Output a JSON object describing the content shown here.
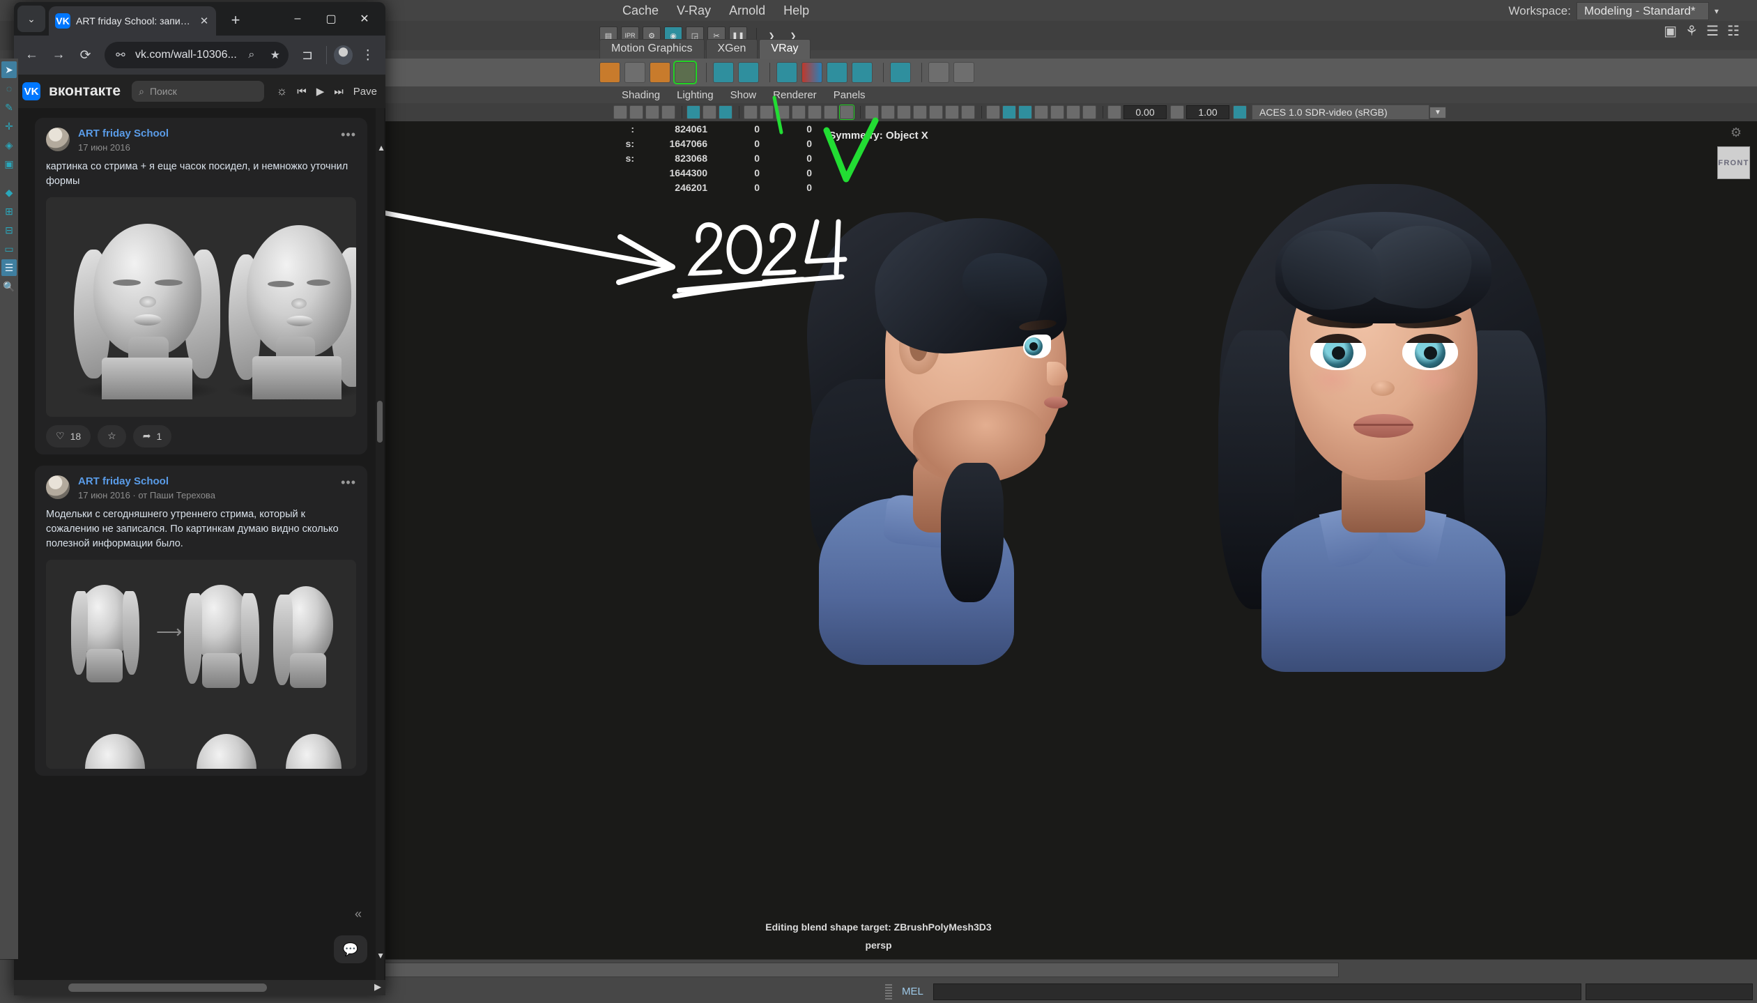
{
  "maya": {
    "menubar": [
      "Cache",
      "V-Ray",
      "Arnold",
      "Help"
    ],
    "workspace_label": "Workspace:",
    "workspace_value": "Modeling - Standard*",
    "shelf_tabs": [
      {
        "label": "Motion Graphics",
        "active": false
      },
      {
        "label": "XGen",
        "active": false
      },
      {
        "label": "VRay",
        "active": true
      }
    ],
    "panel_menus": [
      "Shading",
      "Lighting",
      "Show",
      "Renderer",
      "Panels"
    ],
    "view_toolbar": {
      "gamma": "0.00",
      "exposure": "1.00",
      "color_management": "ACES 1.0 SDR-video (sRGB)"
    },
    "hud": {
      "symmetry": "Symmetry: Object X",
      "viewcube": "FRONT",
      "rows": [
        {
          "label": ":",
          "v1": "824061",
          "v2": "0",
          "v3": "0"
        },
        {
          "label": "s:",
          "v1": "1647066",
          "v2": "0",
          "v3": "0"
        },
        {
          "label": "s:",
          "v1": "823068",
          "v2": "0",
          "v3": "0"
        },
        {
          "label": "",
          "v1": "1644300",
          "v2": "0",
          "v3": "0"
        },
        {
          "label": "",
          "v1": "246201",
          "v2": "0",
          "v3": "0"
        }
      ],
      "status_line": "Editing blend shape target: ZBrushPolyMesh3D3",
      "camera_name": "persp"
    },
    "command_line": {
      "language": "MEL"
    }
  },
  "annotations": {
    "year_text": "2024",
    "arrow_color": "#ffffff",
    "check_color": "#22dd33"
  },
  "browser": {
    "tab": {
      "title": "ART friday School: записи сообщества",
      "favicon": "vk-icon",
      "close": "✕"
    },
    "new_tab_label": "+",
    "window_controls": {
      "minimize": "–",
      "maximize": "▢",
      "close": "✕"
    },
    "toolbar": {
      "back": "←",
      "forward": "→",
      "reload": "⟳",
      "site_info": "tune-icon",
      "url": "vk.com/wall-10306...",
      "zoom": "search-icon",
      "bookmark": "★",
      "extensions": "puzzle-icon",
      "menu": "⋮"
    }
  },
  "vk": {
    "brand": "вконтакте",
    "search_placeholder": "Поиск",
    "header_right": {
      "bell": "notifications-icon",
      "prev": "◀|",
      "play": "▶",
      "next": "|▶",
      "user": "Pave"
    },
    "posts": [
      {
        "author": "ART friday School",
        "meta": "17 июн 2016",
        "text": "картинка со стрима + я еще часок посидел, и немножко уточнил формы",
        "menu": "•••",
        "actions": {
          "likes": "18",
          "comments": "",
          "shares": "1"
        }
      },
      {
        "author": "ART friday School",
        "meta": "17 июн 2016 · от Паши Терехова",
        "text": "Модельки с сегодняшнего утреннего стрима, который к сожалению не записался. По картинкам думаю видно сколько полезной информации было.",
        "menu": "•••",
        "actions": {
          "likes": "",
          "comments": "",
          "shares": ""
        }
      }
    ],
    "collapse_icon": "«",
    "fab_icon": "💬"
  }
}
